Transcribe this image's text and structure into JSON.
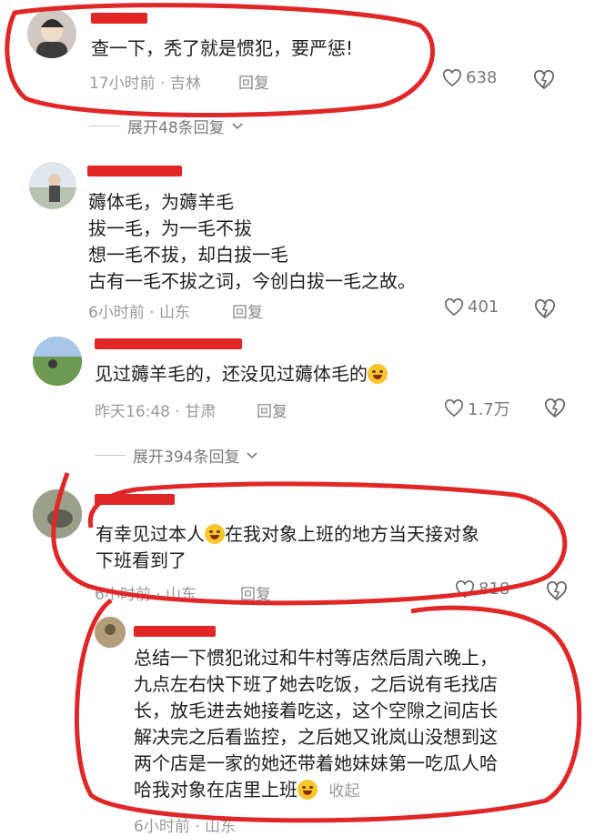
{
  "comments": [
    {
      "text_lines": [
        "查一下，秃了就是惯犯，要严惩!"
      ],
      "time": "17小时前",
      "location": "吉林",
      "reply_label": "回复",
      "likes": "638"
    },
    {
      "text_lines": [
        "薅体毛，为薅羊毛",
        "拔一毛，为一毛不拔",
        "想一毛不拔，却白拔一毛",
        "古有一毛不拔之词，今创白拔一毛之故。"
      ],
      "time": "6小时前",
      "location": "山东",
      "reply_label": "回复",
      "likes": "401"
    },
    {
      "text_lines": [
        "见过薅羊毛的，还没见过薅体毛的"
      ],
      "time": "昨天16:48",
      "location": "甘肃",
      "reply_label": "回复",
      "likes": "1.7万"
    },
    {
      "text_line1_a": "有幸见过本人",
      "text_line1_b": "在我对象上班的地方当天接对象",
      "text_line2": "下班看到了",
      "time": "6小时前",
      "location": "山东",
      "reply_label": "回复",
      "likes": "818"
    },
    {
      "text_lines": [
        "总结一下惯犯讹过和牛村等店然后周六晚上，",
        "九点左右快下班了她去吃饭，之后说有毛找店",
        "长，放毛进去她接着吃这，这个空隙之间店长",
        "解决完之后看监控，之后她又讹岚山没想到这",
        "两个店是一家的她还带着她妹妹第一吃瓜人哈"
      ],
      "last_line": "哈我对象在店里上班",
      "collapse_label": "收起",
      "time": "6小时前",
      "location": "山东"
    }
  ],
  "expand_replies": [
    {
      "label": "展开48条回复"
    },
    {
      "label": "展开394条回复"
    }
  ],
  "separator": "·",
  "colors": {
    "highlight": "#e02626",
    "muted": "#9a9a9a"
  }
}
